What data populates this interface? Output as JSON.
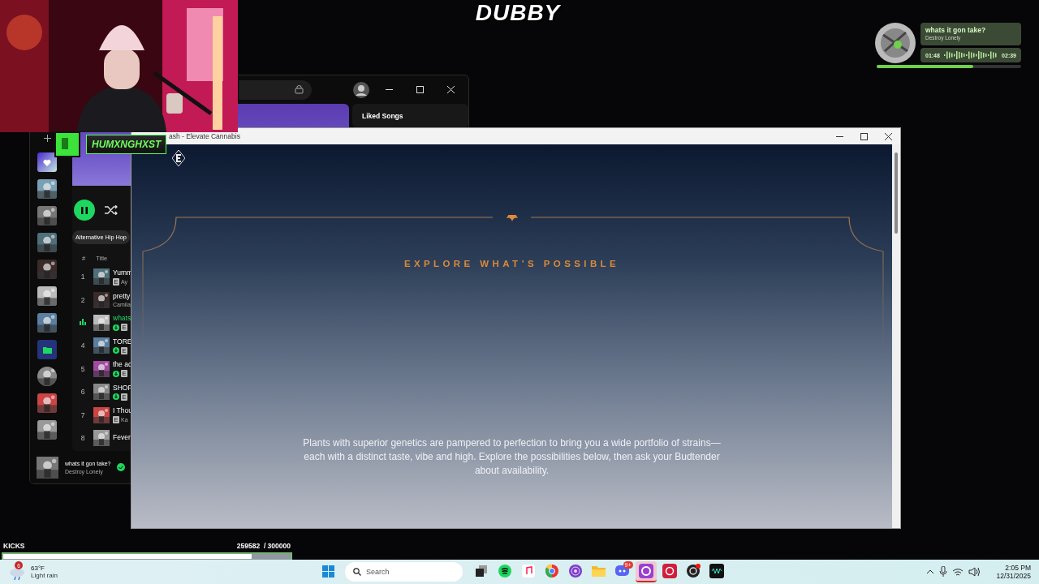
{
  "stream_logo": "DUBBY",
  "now_playing": {
    "title": "whats it gon take?",
    "artist": "Destroy Lonely",
    "elapsed": "01:48",
    "total": "02:39",
    "level": 0.67
  },
  "channel_badge": {
    "name": "HUMXNGHXST"
  },
  "spotify": {
    "right_panel_title": "Liked Songs",
    "genre_chip": "Alternative Hip Hop",
    "columns": [
      "#",
      "Title"
    ],
    "sidebar_items": [
      {
        "kind": "liked"
      },
      {
        "kind": "picture"
      },
      {
        "kind": "picture"
      },
      {
        "kind": "picture"
      },
      {
        "kind": "picture"
      },
      {
        "kind": "picture"
      },
      {
        "kind": "picture"
      },
      {
        "kind": "folder"
      },
      {
        "kind": "round"
      },
      {
        "kind": "picture"
      },
      {
        "kind": "picture"
      }
    ],
    "tracks": [
      {
        "number": "1",
        "title": "Yumm",
        "explicit_mark": "E",
        "subtitle": "Ay",
        "downloaded": false,
        "playing": false
      },
      {
        "number": "2",
        "title": "pretty",
        "subtitle": "Camila",
        "downloaded": false,
        "playing": false
      },
      {
        "title": "whats",
        "explicit_mark": "E",
        "downloaded": true,
        "playing": true
      },
      {
        "number": "4",
        "title": "TORE",
        "explicit_mark": "E",
        "downloaded": true,
        "playing": false
      },
      {
        "number": "5",
        "title": "the ac",
        "explicit_mark": "E",
        "downloaded": true,
        "playing": false
      },
      {
        "number": "6",
        "title": "SHOF",
        "explicit_mark": "E",
        "downloaded": true,
        "playing": false
      },
      {
        "number": "7",
        "title": "I Thou",
        "explicit_mark": "E",
        "subtitle": "Ka",
        "downloaded": false,
        "playing": false
      },
      {
        "number": "8",
        "title": "Fever",
        "downloaded": false,
        "playing": false
      }
    ],
    "player": {
      "title": "whats it gon take?",
      "artist": "Destroy Lonely",
      "saved": true
    }
  },
  "browser": {
    "title": "ash - Elevate Cannabis",
    "heading": "EXPLORE WHAT’S POSSIBLE",
    "body": "Plants with superior genetics are pampered to perfection to bring you a wide portfolio of strains—each with a distinct taste, vibe and high. Explore the possibilities below, then ask your Budtender about availability."
  },
  "kicks": {
    "label": "KICKS",
    "count": "259582  / 300000",
    "level": 0.865
  },
  "taskbar": {
    "weather": {
      "temperature": "63°F",
      "condition": "Light rain",
      "badge": "6"
    },
    "search_placeholder": "Search",
    "apps": [
      {
        "kind": "taskview",
        "selected": false
      },
      {
        "kind": "music",
        "selected": false
      },
      {
        "kind": "note",
        "selected": false
      },
      {
        "kind": "browser",
        "selected": false
      },
      {
        "kind": "onion",
        "selected": false
      },
      {
        "kind": "folder",
        "selected": false
      },
      {
        "kind": "chat",
        "badge": "9+",
        "selected": false
      },
      {
        "kind": "ring",
        "selected": true
      },
      {
        "kind": "record",
        "selected": false
      },
      {
        "kind": "obs",
        "selected": false
      },
      {
        "kind": "wave",
        "selected": false
      }
    ],
    "time": "2:05 PM",
    "date": "12/31/2025"
  }
}
